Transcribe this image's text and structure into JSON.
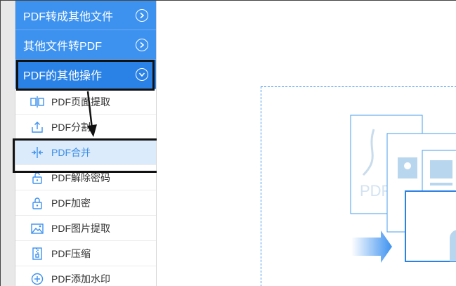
{
  "sidebar": {
    "sections": [
      {
        "label": "PDF转成其他文件",
        "expanded": false
      },
      {
        "label": "其他文件转PDF",
        "expanded": false
      },
      {
        "label": "PDF的其他操作",
        "expanded": true
      }
    ],
    "items": [
      {
        "label": "PDF页面提取",
        "icon": "page-extract-icon"
      },
      {
        "label": "PDF分割",
        "icon": "split-icon"
      },
      {
        "label": "PDF合并",
        "icon": "merge-icon",
        "selected": true
      },
      {
        "label": "PDF解除密码",
        "icon": "unlock-icon"
      },
      {
        "label": "PDF加密",
        "icon": "lock-icon"
      },
      {
        "label": "PDF图片提取",
        "icon": "image-extract-icon"
      },
      {
        "label": "PDF压缩",
        "icon": "compress-icon"
      },
      {
        "label": "PDF添加水印",
        "icon": "watermark-icon"
      }
    ]
  },
  "colors": {
    "accent": "#3d92f0",
    "selected_bg": "#dcebfb",
    "selected_text": "#3a8ee6"
  },
  "main": {
    "illustration_text": "PDF"
  }
}
